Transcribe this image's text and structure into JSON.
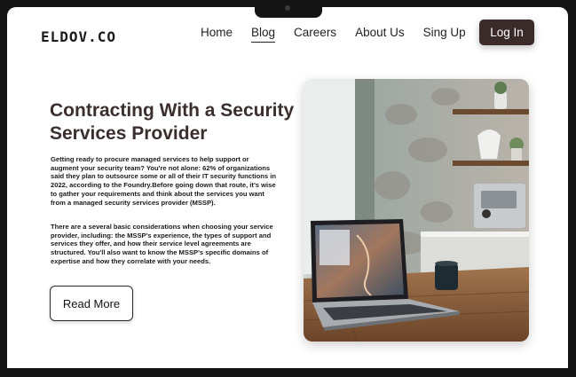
{
  "brand": {
    "logo": "ELDOV.CO"
  },
  "nav": {
    "items": [
      {
        "label": "Home",
        "active": false
      },
      {
        "label": "Blog",
        "active": true
      },
      {
        "label": "Careers",
        "active": false
      },
      {
        "label": "About Us",
        "active": false
      },
      {
        "label": "Sing Up",
        "active": false
      }
    ],
    "login_label": "Log In"
  },
  "hero": {
    "title": "Contracting With a Security Services Provider",
    "paragraph1": "Getting ready to procure managed services to help support or augment your security team? You're not alone: 62% of organizations said they plan to outsource some or all of their IT security functions in 2022, according to the Foundry.Before going down that route, it's wise to gather your requirements and think about the services you want from a managed security services provider (MSSP).",
    "paragraph2": "There are a several basic considerations when choosing your service provider, including: the MSSP's experience, the types of support and services they offer, and how their service level agreements are structured. You'll also want to know the MSSP's specific domains of expertise and how they correlate with your needs.",
    "cta_label": "Read More"
  },
  "colors": {
    "login_bg": "#3b2a2a",
    "title": "#3a2e2e",
    "device_frame": "#141414"
  }
}
